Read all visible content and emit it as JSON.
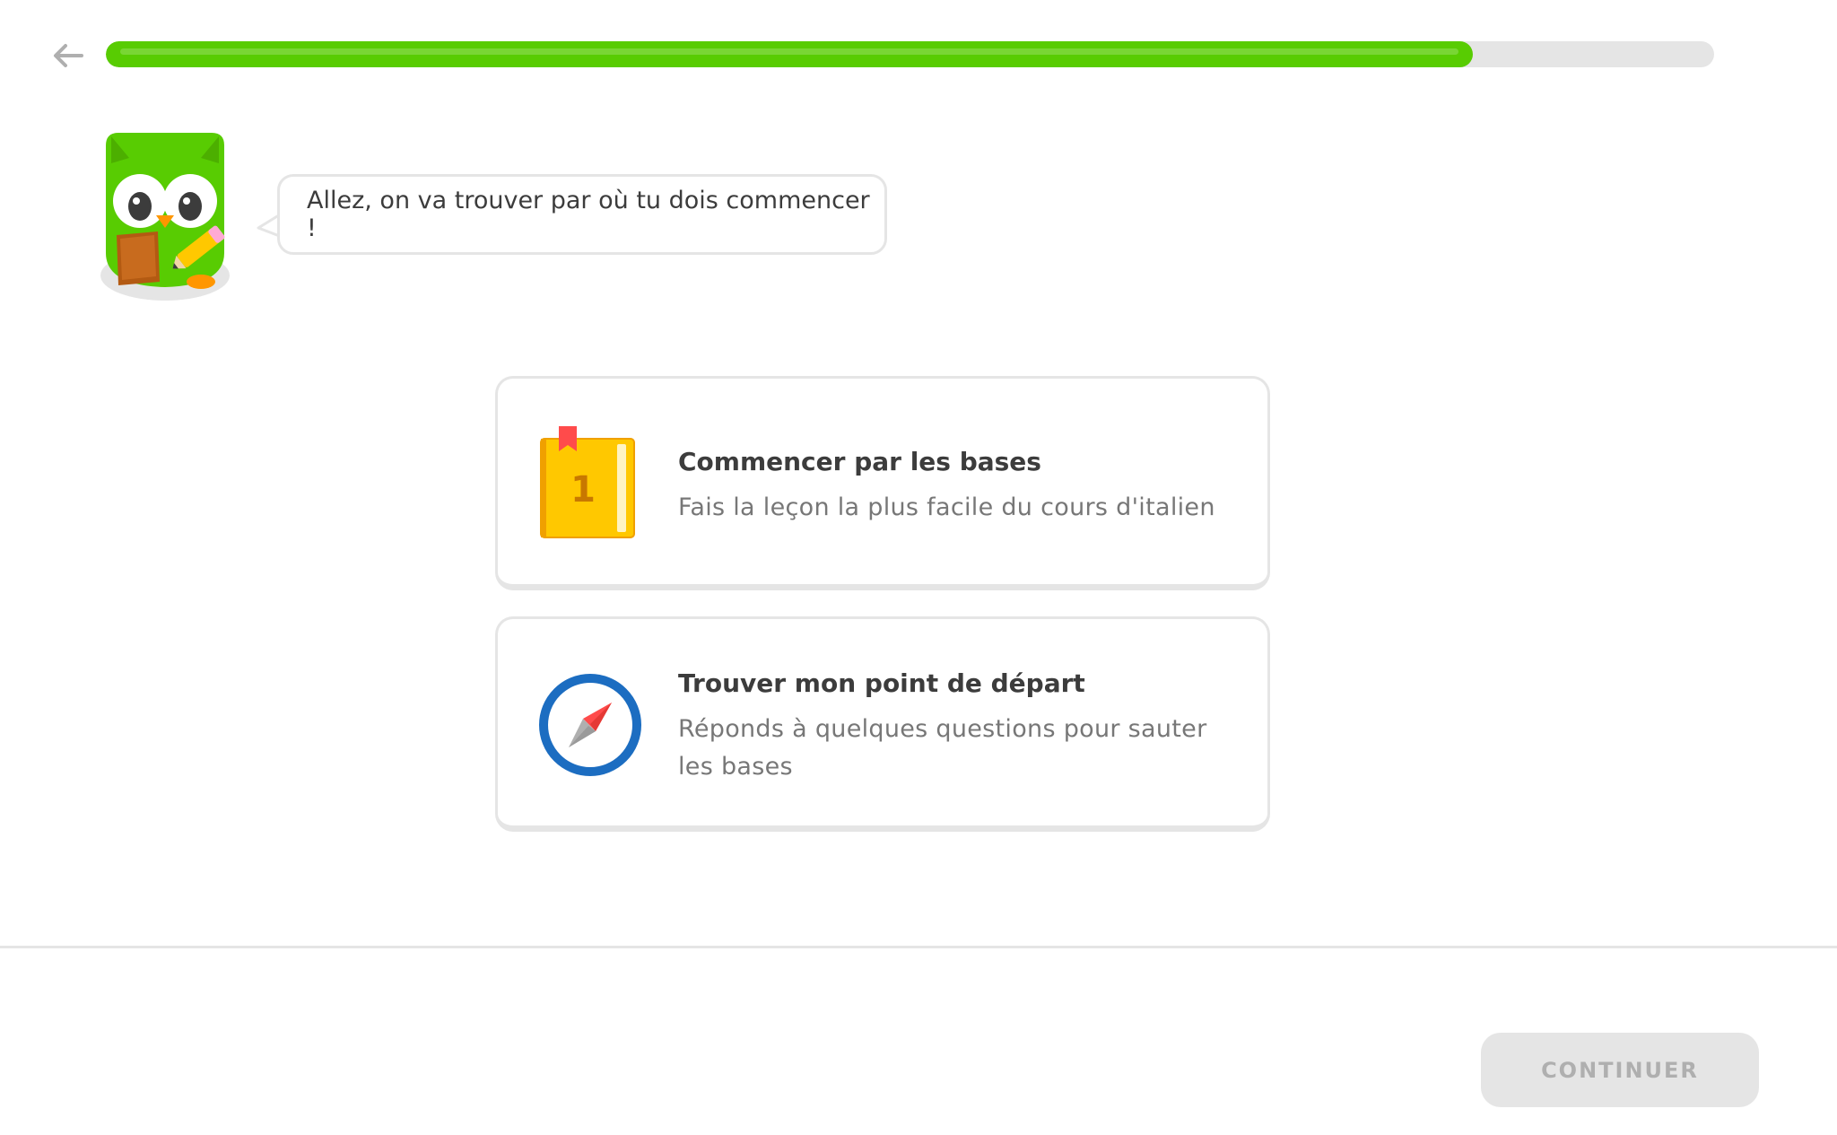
{
  "header": {
    "back_icon": "arrow-left-icon",
    "progress": 0.85,
    "progress_color": "#58cc02",
    "progress_track_color": "#e5e5e5"
  },
  "mascot": {
    "icon": "owl-mascot-with-clipboard",
    "speech": "Allez, on va trouver par où tu dois commencer !"
  },
  "options": [
    {
      "icon": "book-lesson-1-icon",
      "icon_number": "1",
      "title": "Commencer par les bases",
      "description": "Fais la leçon la plus facile du cours d'italien"
    },
    {
      "icon": "compass-icon",
      "title": "Trouver mon point de départ",
      "description": "Réponds à quelques questions pour sauter les bases"
    }
  ],
  "footer": {
    "continue_label": "CONTINUER",
    "continue_enabled": false
  }
}
